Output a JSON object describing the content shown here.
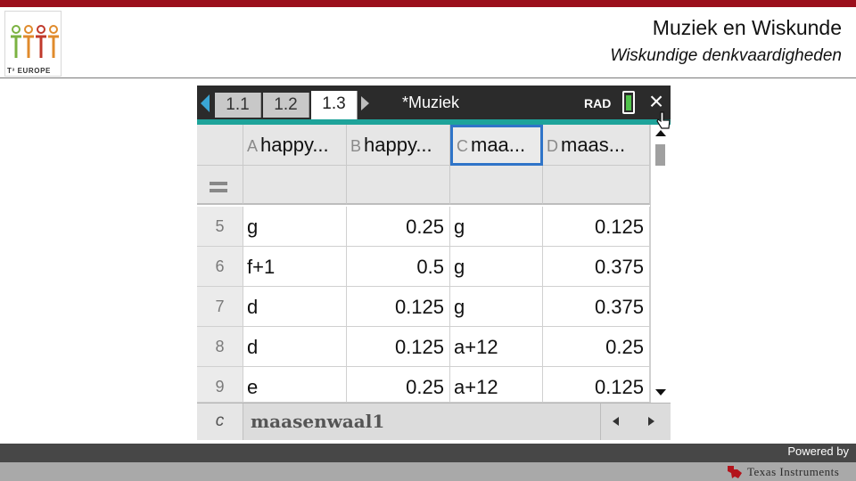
{
  "brand": {
    "accent": "#9b0f1c",
    "logo_text": "T³ EUROPE"
  },
  "slide": {
    "title": "Muziek en Wiskunde",
    "subtitle": "Wiskundige denkvaardigheden"
  },
  "calculator": {
    "tabs": [
      "1.1",
      "1.2",
      "1.3"
    ],
    "active_tab": "1.3",
    "document": "*Muziek",
    "mode": "RAD",
    "colors": {
      "teal": "#1ea39a",
      "selection": "#2f74c8",
      "battery": "#4fc24a"
    },
    "columns": [
      {
        "letter": "A",
        "label": "happy..."
      },
      {
        "letter": "B",
        "label": "happy..."
      },
      {
        "letter": "C",
        "label": "maa..."
      },
      {
        "letter": "D",
        "label": "maas..."
      }
    ],
    "selected_column": "C",
    "formula_symbol": "=",
    "rows": [
      {
        "num": "5",
        "a": "g",
        "b": "0.25",
        "c": "g",
        "d": "0.125"
      },
      {
        "num": "6",
        "a": "f+1",
        "b": "0.5",
        "c": "g",
        "d": "0.375"
      },
      {
        "num": "7",
        "a": "d",
        "b": "0.125",
        "c": "g",
        "d": "0.375"
      },
      {
        "num": "8",
        "a": "d",
        "b": "0.125",
        "c": "a+12",
        "d": "0.25"
      },
      {
        "num": "9",
        "a": "e",
        "b": "0.25",
        "c": "a+12",
        "d": "0.125"
      }
    ],
    "entry_line": {
      "label": "c",
      "value": "maasenwaal1"
    }
  },
  "footer": {
    "powered_by": "Powered by",
    "company": "Texas Instruments"
  }
}
